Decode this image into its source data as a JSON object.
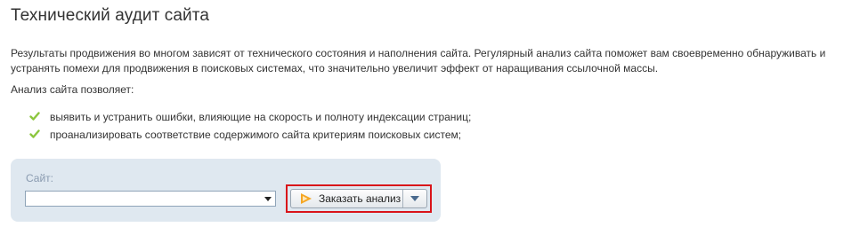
{
  "page": {
    "title": "Технический аудит сайта",
    "intro_line1": "Результаты продвижения во многом зависят от технического состояния и наполнения сайта. Регулярный анализ сайта поможет вам своевременно обнаруживать и",
    "intro_line2": "устранять помехи для продвижения в поисковых системах, что значительно увеличит эффект от наращивания ссылочной массы.",
    "lead": "Анализ сайта позволяет:",
    "bullets": [
      {
        "text": "выявить и устранить ошибки, влияющие на скорость и полноту индексации страниц;",
        "icon": "checkmark-icon"
      },
      {
        "text": "проанализировать соответствие содержимого сайта критериям поисковых систем;",
        "icon": "checkmark-icon"
      }
    ]
  },
  "form": {
    "site_label": "Сайт:",
    "site_select_value": "",
    "order_button_label": "Заказать анализ",
    "order_button_icon": "play-icon",
    "dropdown_icon": "chevron-down-icon"
  },
  "colors": {
    "check_green": "#8cc63e",
    "panel_bg": "#dfe8f0",
    "highlight_red": "#d9141a",
    "play_orange": "#f5a623"
  }
}
